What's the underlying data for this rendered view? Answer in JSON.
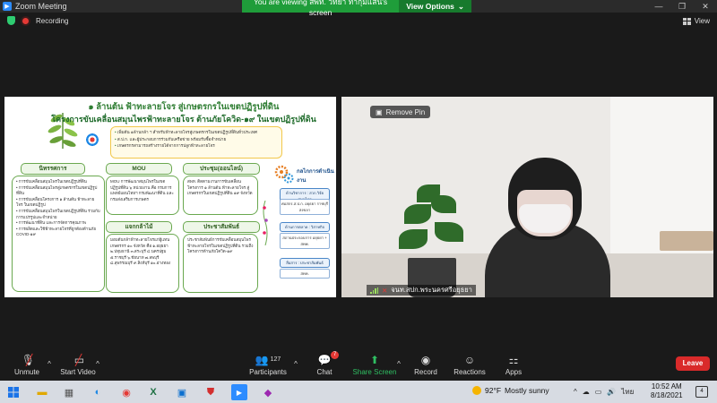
{
  "window": {
    "title": "Zoom Meeting"
  },
  "banner": {
    "viewing": "You are viewing สพท. วิทยา ท่ากุมแสน's screen",
    "view_options": "View Options"
  },
  "status": {
    "recording": "Recording",
    "view": "View"
  },
  "slide": {
    "title1": "๑ ล้านต้น ฟ้าทะลายโจร สู่เกษตรกรในเขตปฏิรูปที่ดิน",
    "title2": "โครงการขับเคลื่อนสมุนไพรฟ้าทะลายโจร ต้านภัยโควิด-๑๙ ในเขตปฏิรูปที่ดิน",
    "goals": [
      "เพิ่มต้น ๑ล้านกล้า ฯ สำหรับฟ้าทะลายโจรสู่เกษตรกรในเขตปฏิรูปที่ดินทั่วประเทศ",
      "ส.ป.ก. และผู้ประกอบการร่วมกับเครือข่าย พร้อมรับซื้อจำหน่าย",
      "เกษตรกรสามารถสร้างรายได้จากการปลูกฟ้าทะลายโจร"
    ],
    "columns": [
      {
        "header": "นิทรรศการ",
        "items": [
          "การขับเคลื่อนสมุนไพรในเขตปฏิรูปที่ดิน",
          "การขับเคลื่อนสมุนไพรสู่เกษตรกรในเขตปฏิรูปที่ดิน",
          "การขับเคลื่อนโครงการ ๑ ล้านต้น ฟ้าทะลายโจร ในเขตปฏิรูป",
          "การขับเคลื่อนสมุนไพรในเขตปฏิรูปที่ดิน ร่วมกับ การแปรรูปและจำหน่าย",
          "การพัฒนาที่ดิน และการจัดการคุณภาพ",
          "การผลิตและใช้ฟ้าทะลายโจรที่ถูกต้องต้านภัย COVID-๑๙"
        ]
      },
      {
        "header": "MOU",
        "items": [
          "MOU การพัฒนาสมุนไพรในเขตปฏิรูปที่ดิน ๖ หน่วยงาน คือ กรมการแพทย์แผนไทยฯ กรมพัฒนาที่ดิน และกรมส่งเสริมการเกษตร"
        ]
      },
      {
        "header": "ประชุม(ออนไลน์)",
        "items": [
          "สพท. ติดตามงานการขับเคลื่อนโครงการ ๑ ล้านต้น ฟ้าทะลายโจร สู่เกษตรกรในเขตปฏิรูปที่ดิน ๑๙ จังหวัด"
        ]
      },
      {
        "header": "แจกกล้าไม้",
        "items": [
          "มอบต้นกล้าฟ้าทะลายโจรแก่ผู้แทนเกษตรกร ๑๐ จังหวัด คือ ๑.อยุธยา ๒.ปทุมธานี ๓.สระบุรี ๔.นครปฐม ๕.ราชบุรี ๖.ชัยนาท ๗.ลพบุรี ๘.สุพรรณบุรี ๙.สิงห์บุรี ๑๐.อ่างทอง"
        ]
      },
      {
        "header": "ประชาสัมพันธ์",
        "items": [
          "ประชาสัมพันธ์การขับเคลื่อนสมุนไพรฟ้าทะลายโจรในเขตปฏิรูปที่ดิน รวมถึงโครงการต้านภัยโควิด-๑๙"
        ]
      }
    ],
    "steps": {
      "title": "กลไกการดำเนินงาน",
      "items": [
        {
          "label": "ด้านวิชาการ : สวก.วิจัยสมุนไพร",
          "sub": "ศอสกร.ส.ป.ก. อยุธยา ราชบุรี สงขลา"
        },
        {
          "label": "ด้านการตลาด : วิสาหกิจ",
          "sub": "สถานประกอบการ อยุธยา + สทพ."
        },
        {
          "label": "สื่อสาร : ประชาสัมพันธ์",
          "sub": "สทท."
        }
      ]
    }
  },
  "camera": {
    "remove_pin": "Remove Pin",
    "name_tag": "จนท.สปก.พระนครศรีอยุธยา"
  },
  "toolbar": {
    "unmute": "Unmute",
    "start_video": "Start Video",
    "participants": "Participants",
    "participants_count": "127",
    "chat": "Chat",
    "chat_badge": "7",
    "share_screen": "Share Screen",
    "record": "Record",
    "reactions": "Reactions",
    "apps": "Apps",
    "leave": "Leave"
  },
  "taskbar": {
    "weather_temp": "92°F",
    "weather_text": "Mostly sunny",
    "lang": "ไทย",
    "time": "10:52 AM",
    "date": "8/18/2021",
    "notif_count": "4"
  },
  "colors": {
    "banner_green": "#1f9d3a",
    "leave_red": "#d92a2a",
    "share_green": "#2fbf62"
  }
}
